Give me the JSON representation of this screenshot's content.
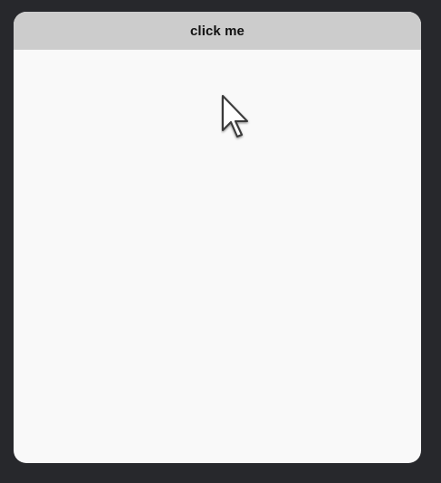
{
  "window": {
    "button_label": "click me"
  },
  "pointer": {
    "icon": "mouse-pointer-icon"
  },
  "colors": {
    "background": "#27282c",
    "card": "#f9f9f9",
    "header": "#cccccc",
    "text": "#111111"
  }
}
